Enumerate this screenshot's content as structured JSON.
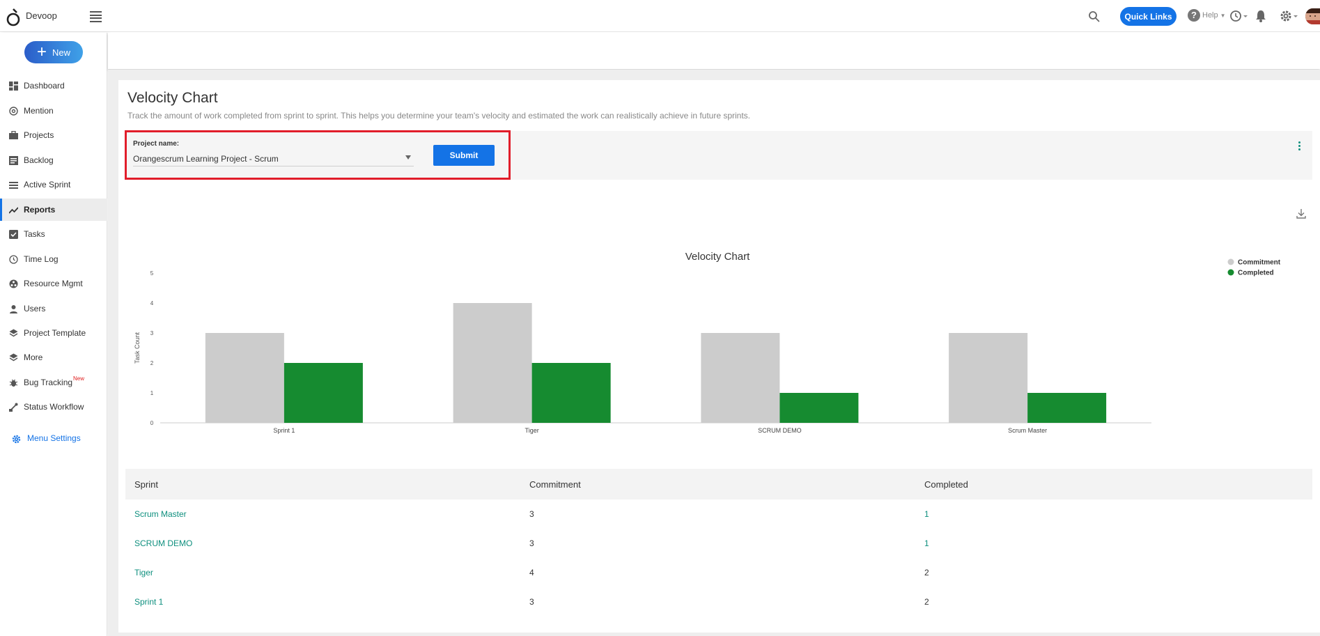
{
  "app": {
    "brand": "Devoop"
  },
  "topbar": {
    "quick_links_label": "Quick Links",
    "help_label": "Help",
    "icons": [
      "search-icon",
      "help-icon",
      "clock-icon",
      "bell-icon",
      "gear-icon",
      "avatar"
    ]
  },
  "sidebar": {
    "new_label": "New",
    "items": [
      {
        "label": "Dashboard",
        "icon": "dashboard-icon"
      },
      {
        "label": "Mention",
        "icon": "at-icon"
      },
      {
        "label": "Projects",
        "icon": "briefcase-icon"
      },
      {
        "label": "Backlog",
        "icon": "backlog-icon"
      },
      {
        "label": "Active Sprint",
        "icon": "sprint-icon"
      },
      {
        "label": "Reports",
        "icon": "trend-icon",
        "active": true
      },
      {
        "label": "Tasks",
        "icon": "check-box-icon"
      },
      {
        "label": "Time Log",
        "icon": "clock-icon"
      },
      {
        "label": "Resource Mgmt",
        "icon": "resource-icon"
      },
      {
        "label": "Users",
        "icon": "user-icon"
      },
      {
        "label": "Project Template",
        "icon": "layers-icon"
      },
      {
        "label": "More",
        "icon": "layers-icon"
      },
      {
        "label": "Bug Tracking",
        "icon": "bug-icon",
        "badge": "New"
      },
      {
        "label": "Status Workflow",
        "icon": "workflow-icon"
      }
    ],
    "menu_settings_label": "Menu Settings"
  },
  "page": {
    "title": "Velocity Chart",
    "description": "Track the amount of work completed from sprint to sprint. This helps you determine your team's velocity and estimated the work can realistically achieve in future sprints."
  },
  "filter": {
    "project_label": "Project name:",
    "project_value": "Orangescrum Learning Project - Scrum",
    "submit_label": "Submit"
  },
  "chart_data": {
    "type": "bar",
    "title": "Velocity Chart",
    "ylabel": "Task Count",
    "xlabel": "",
    "categories": [
      "Sprint 1",
      "Tiger",
      "SCRUM DEMO",
      "Scrum Master"
    ],
    "series": [
      {
        "name": "Commitment",
        "values": [
          3,
          4,
          3,
          3
        ],
        "color": "#cccccc"
      },
      {
        "name": "Completed",
        "values": [
          2,
          2,
          1,
          1
        ],
        "color": "#168b30"
      }
    ],
    "ylim": [
      0,
      5
    ],
    "yticks": [
      0,
      1,
      2,
      3,
      4,
      5
    ],
    "legend_position": "top-right",
    "grid": false
  },
  "table": {
    "headers": [
      "Sprint",
      "Commitment",
      "Completed"
    ],
    "rows": [
      {
        "sprint": "Scrum Master",
        "commitment": "3",
        "completed": "1"
      },
      {
        "sprint": "SCRUM DEMO",
        "commitment": "3",
        "completed": "1"
      },
      {
        "sprint": "Tiger",
        "commitment": "4",
        "completed": "2"
      },
      {
        "sprint": "Sprint 1",
        "commitment": "3",
        "completed": "2"
      }
    ]
  }
}
